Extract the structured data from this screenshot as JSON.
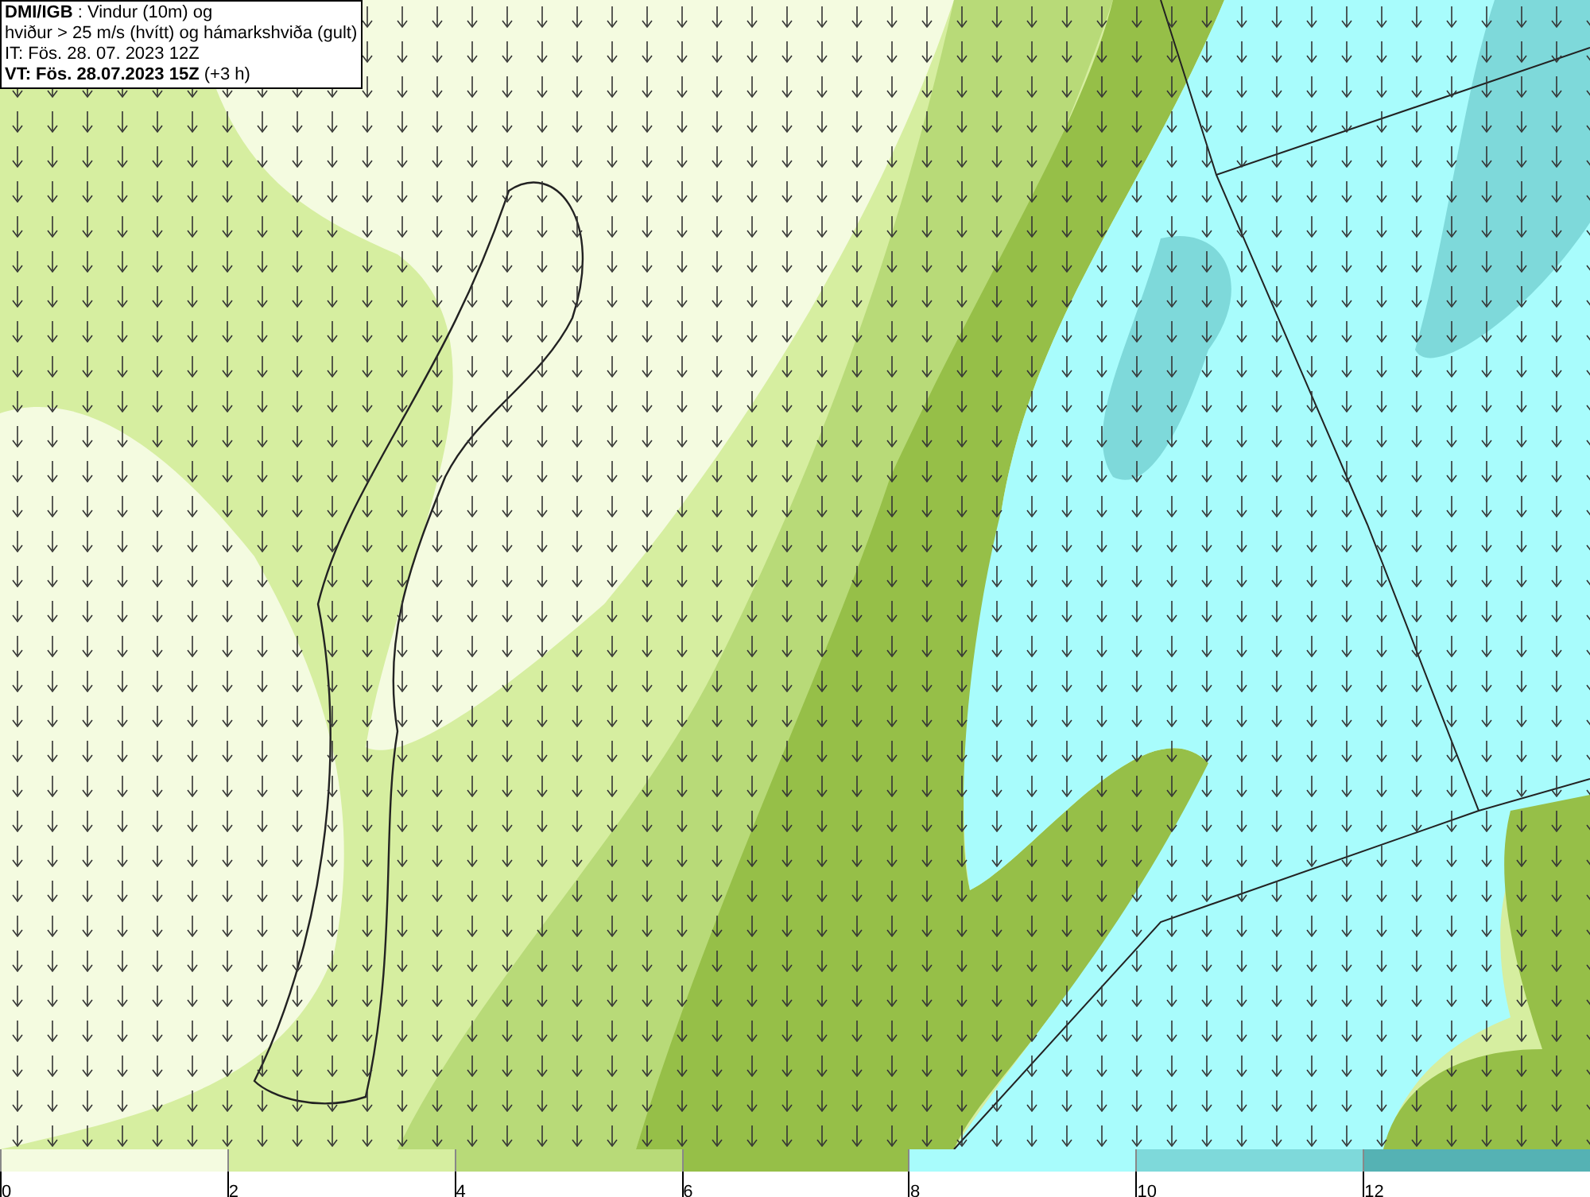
{
  "title_box": {
    "lines": [
      "**DMI/IGB** : Vindur (10m) og",
      "hviður > 25 m/s (hvítt) og hámarkshviða (gult)",
      "IT: Fös. 28. 07. 2023 12Z",
      "**VT: Fös. 28.07.2023 15Z** (+3 h)"
    ]
  },
  "legend": {
    "bins": [
      {
        "label": "0",
        "color": "#f4fbe0"
      },
      {
        "label": "2",
        "color": "#d6eea0"
      },
      {
        "label": "4",
        "color": "#b8da78"
      },
      {
        "label": "6",
        "color": "#96bf48"
      },
      {
        "label": "8",
        "color": "#a8fcfc"
      },
      {
        "label": "10",
        "color": "#7ed9da"
      },
      {
        "label": "12",
        "color": "#55b2b4"
      }
    ]
  }
}
